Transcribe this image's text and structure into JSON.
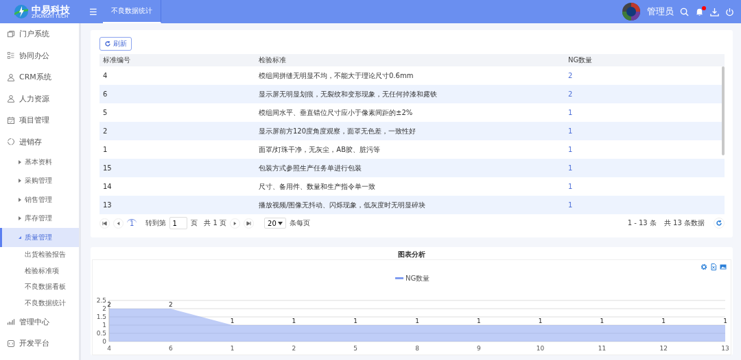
{
  "header": {
    "logo_text": "中易科技",
    "logo_subtitle": "ZHONGYI TECH",
    "menu_glyph": "☰",
    "tabs": [
      {
        "label": "不良数据统计",
        "selected": true
      }
    ],
    "user": "管理员",
    "notification": true
  },
  "sidebar": {
    "items": [
      {
        "label": "门户系统"
      },
      {
        "label": "协同办公"
      },
      {
        "label": "CRM系统"
      },
      {
        "label": "人力资源"
      },
      {
        "label": "项目管理"
      },
      {
        "label": "进销存",
        "children": [
          {
            "label": "基本资料",
            "expanded": false,
            "selected": false
          },
          {
            "label": "采购管理",
            "expanded": false,
            "selected": false
          },
          {
            "label": "销售管理",
            "expanded": false,
            "selected": false
          },
          {
            "label": "库存管理",
            "expanded": false,
            "selected": false
          },
          {
            "label": "质量管理",
            "expanded": true,
            "selected": true,
            "children": [
              {
                "label": "出货检验报告"
              },
              {
                "label": "检验标准项"
              },
              {
                "label": "不良数据看板"
              },
              {
                "label": "不良数据统计"
              }
            ]
          }
        ]
      },
      {
        "label": "管理中心"
      },
      {
        "label": "开发平台"
      }
    ]
  },
  "toolbar": {
    "refresh_button": "刷新"
  },
  "table": {
    "columns": [
      "标准编号",
      "检验标准",
      "NG数量"
    ],
    "rows": [
      [
        "4",
        "模组间拼缝无明显不均，不能大于理论尺寸0.6mm",
        "2"
      ],
      [
        "6",
        "显示屏无明显划痕，无裂纹和变形现象，无任何掉漆和露铁",
        "2"
      ],
      [
        "5",
        "模组间水平、垂直错位尺寸应小于像素间距的±2%",
        "1"
      ],
      [
        "2",
        "显示屏前方120度角度观察，面罩无色差，一致性好",
        "1"
      ],
      [
        "1",
        "面罩/灯珠干净，无灰尘，AB胶、脏污等",
        "1"
      ],
      [
        "15",
        "包装方式参照生产任务单进行包装",
        "1"
      ],
      [
        "14",
        "尺寸、备用件、数量和生产指令单一致",
        "1"
      ],
      [
        "13",
        "播放视频/图像无抖动、闪烁现象，低灰度时无明显碎块",
        "1"
      ]
    ]
  },
  "pagination": {
    "current_page": "1",
    "goto_label": "转到第",
    "goto_value": "1",
    "page_unit": "页",
    "total_pages": "共 1 页",
    "page_size": "20",
    "page_size_label": "条每页",
    "range": "1 - 13 条",
    "total": "共 13 条数据"
  },
  "chart_panel": {
    "title": "图表分析",
    "chart_data": {
      "type": "area",
      "categories": [
        "4",
        "6",
        "1",
        "2",
        "5",
        "8",
        "9",
        "10",
        "11",
        "12",
        "13"
      ],
      "series": [
        {
          "name": "NG数量",
          "color": "#7f9cf0",
          "values": [
            2,
            2,
            1,
            1,
            1,
            1,
            1,
            1,
            1,
            1,
            1
          ]
        }
      ],
      "ylim": [
        0,
        2.5
      ],
      "grid": true,
      "yticks": [
        0,
        0.5,
        1,
        1.5,
        2,
        2.5
      ],
      "data_labels": true
    }
  }
}
